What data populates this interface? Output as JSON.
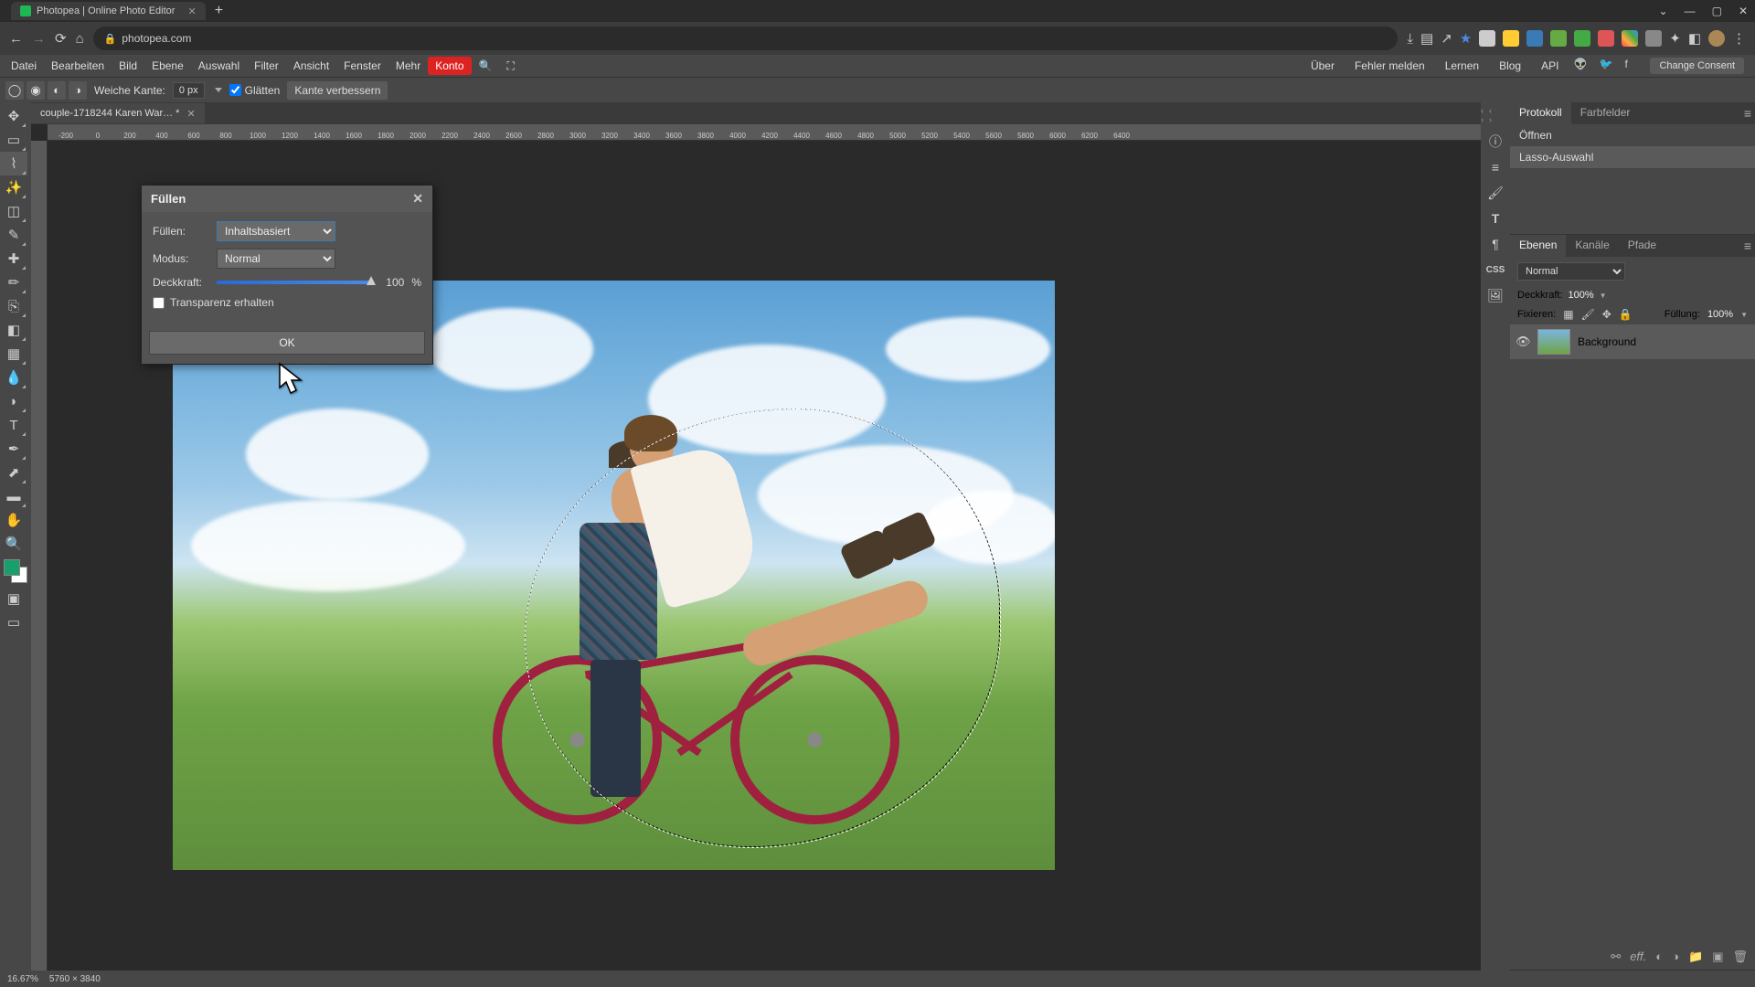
{
  "browser": {
    "tab_title": "Photopea | Online Photo Editor",
    "url": "photopea.com",
    "window_minimize": "—",
    "window_maximize": "▢",
    "window_close": "✕"
  },
  "menubar": {
    "items": [
      "Datei",
      "Bearbeiten",
      "Bild",
      "Ebene",
      "Auswahl",
      "Filter",
      "Ansicht",
      "Fenster",
      "Mehr"
    ],
    "account": "Konto",
    "right_items": [
      "Über",
      "Fehler melden",
      "Lernen",
      "Blog",
      "API"
    ],
    "consent": "Change Consent"
  },
  "options_bar": {
    "feather_label": "Weiche Kante:",
    "feather_value": "0 px",
    "smooth_label": "Glätten",
    "refine_label": "Kante verbessern"
  },
  "doc_tab": {
    "name": "couple-1718244 Karen War… *"
  },
  "ruler_marks": [
    "-200",
    "0",
    "200",
    "400",
    "600",
    "800",
    "1000",
    "1200",
    "1400",
    "1600",
    "1800",
    "2000",
    "2200",
    "2400",
    "2600",
    "2800",
    "3000",
    "3200",
    "3400",
    "3600",
    "3800",
    "4000",
    "4200",
    "4400",
    "4600",
    "4800",
    "5000",
    "5200",
    "5400",
    "5600",
    "5800",
    "6000",
    "6200",
    "6400"
  ],
  "dialog": {
    "title": "Füllen",
    "fill_label": "Füllen:",
    "fill_value": "Inhaltsbasiert",
    "mode_label": "Modus:",
    "mode_value": "Normal",
    "opacity_label": "Deckkraft:",
    "opacity_value": "100",
    "opacity_unit": "%",
    "transparency_label": "Transparenz erhalten",
    "ok": "OK"
  },
  "panels": {
    "history_tab": "Protokoll",
    "swatches_tab": "Farbfelder",
    "history_items": [
      "Öffnen",
      "Lasso-Auswahl"
    ],
    "layers_tab": "Ebenen",
    "channels_tab": "Kanäle",
    "paths_tab": "Pfade",
    "blend_mode": "Normal",
    "opacity_label": "Deckkraft:",
    "opacity_value": "100%",
    "lock_label": "Fixieren:",
    "fill_label": "Füllung:",
    "fill_value": "100%",
    "layer_name": "Background"
  },
  "right_strip": {
    "css_label": "CSS"
  },
  "status": {
    "zoom": "16.67%",
    "dims": "5760 × 3840"
  }
}
